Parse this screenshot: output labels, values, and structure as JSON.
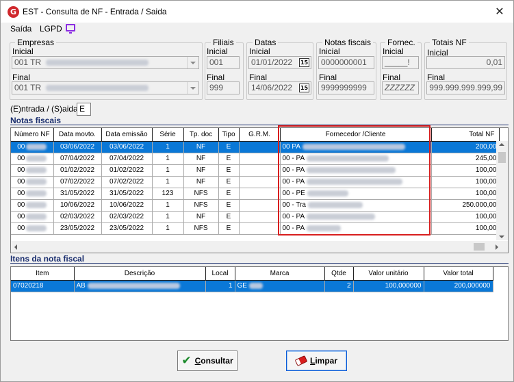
{
  "window": {
    "title": "EST - Consulta de NF - Entrada / Saida",
    "close_glyph": "✕",
    "app_icon_letter": "G"
  },
  "menu": {
    "saida": "Saída",
    "lgpd": "LGPD"
  },
  "filters": {
    "empresas": {
      "legend": "Empresas",
      "inicial_label": "Inicial",
      "inicial_value": "001 TR",
      "final_label": "Final",
      "final_value": "001 TR"
    },
    "filiais": {
      "legend": "Filiais",
      "inicial_label": "Inicial",
      "inicial_value": "001",
      "final_label": "Final",
      "final_value": "999"
    },
    "datas": {
      "legend": "Datas",
      "inicial_label": "Inicial",
      "inicial_value": "01/01/2022",
      "final_label": "Final",
      "final_value": "14/06/2022",
      "cal_glyph": "15"
    },
    "notas": {
      "legend": "Notas fiscais",
      "inicial_label": "Inicial",
      "inicial_value": "0000000001",
      "final_label": "Final",
      "final_value": "9999999999"
    },
    "fornec": {
      "legend": "Fornec.",
      "inicial_label": "Inicial",
      "inicial_value": "_____!",
      "final_label": "Final",
      "final_value": "ZZZZZZ"
    },
    "totais": {
      "legend": "Totais NF",
      "inicial_label": "Inicial",
      "inicial_value": "0,01",
      "final_label": "Final",
      "final_value": "999.999.999.999,99"
    },
    "es_label": "(E)ntrada / (S)aida :",
    "es_value": "E"
  },
  "notas_section": {
    "title": "Notas fiscais",
    "columns": [
      "Número NF",
      "Data movto.",
      "Data emissão",
      "Série",
      "Tp. doc",
      "Tipo",
      "G.R.M.",
      "Fornecedor /Cliente",
      "Total NF"
    ],
    "rows": [
      {
        "numero": "00",
        "data_movto": "03/06/2022",
        "data_emissao": "03/06/2022",
        "serie": "1",
        "tp_doc": "NF",
        "tipo": "E",
        "grm": "",
        "fornecedor": "00 PA",
        "total": "200,00"
      },
      {
        "numero": "00",
        "data_movto": "07/04/2022",
        "data_emissao": "07/04/2022",
        "serie": "1",
        "tp_doc": "NF",
        "tipo": "E",
        "grm": "",
        "fornecedor": "00 - PA",
        "total": "245,00"
      },
      {
        "numero": "00",
        "data_movto": "01/02/2022",
        "data_emissao": "01/02/2022",
        "serie": "1",
        "tp_doc": "NF",
        "tipo": "E",
        "grm": "",
        "fornecedor": "00 - PA",
        "total": "100,00"
      },
      {
        "numero": "00",
        "data_movto": "07/02/2022",
        "data_emissao": "07/02/2022",
        "serie": "1",
        "tp_doc": "NF",
        "tipo": "E",
        "grm": "",
        "fornecedor": "00 - PA",
        "total": "100,00"
      },
      {
        "numero": "00",
        "data_movto": "31/05/2022",
        "data_emissao": "31/05/2022",
        "serie": "123",
        "tp_doc": "NFS",
        "tipo": "E",
        "grm": "",
        "fornecedor": "00 - PE",
        "total": "100,00"
      },
      {
        "numero": "00",
        "data_movto": "10/06/2022",
        "data_emissao": "10/06/2022",
        "serie": "1",
        "tp_doc": "NFS",
        "tipo": "E",
        "grm": "",
        "fornecedor": "00 - Tra",
        "total": "250.000,00"
      },
      {
        "numero": "00",
        "data_movto": "02/03/2022",
        "data_emissao": "02/03/2022",
        "serie": "1",
        "tp_doc": "NF",
        "tipo": "E",
        "grm": "",
        "fornecedor": "00 - PA",
        "total": "100,00"
      },
      {
        "numero": "00",
        "data_movto": "23/05/2022",
        "data_emissao": "23/05/2022",
        "serie": "1",
        "tp_doc": "NFS",
        "tipo": "E",
        "grm": "",
        "fornecedor": "00 - PA",
        "total": "100,00"
      }
    ]
  },
  "itens_section": {
    "title": "Itens da nota fiscal",
    "columns": [
      "Item",
      "Descrição",
      "Local",
      "Marca",
      "Qtde",
      "Valor unitário",
      "Valor total"
    ],
    "rows": [
      {
        "item": "07020218",
        "descricao": "AB",
        "local": "1",
        "marca": "GE",
        "qtde": "2",
        "valor_unitario": "100,000000",
        "valor_total": "200,000000"
      }
    ]
  },
  "buttons": {
    "consultar": "onsultar",
    "consultar_key": "C",
    "limpar": "impar",
    "limpar_key": "L"
  },
  "colors": {
    "accent": "#0a78d7",
    "section_title": "#1a2e6e",
    "highlight": "#d81e1e"
  }
}
